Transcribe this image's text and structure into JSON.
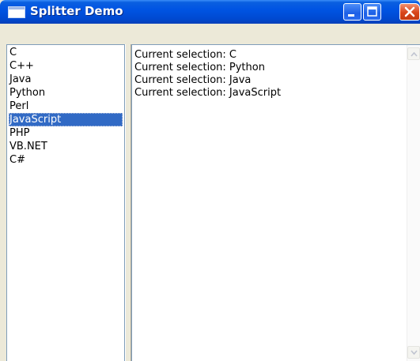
{
  "window": {
    "title": "Splitter Demo",
    "icons": {
      "app": "window-icon",
      "minimize": "minimize-icon",
      "maximize": "maximize-icon",
      "close": "close-icon"
    }
  },
  "language_list": {
    "items": [
      "C",
      "C++",
      "Java",
      "Python",
      "Perl",
      "JavaScript",
      "PHP",
      "VB.NET",
      "C#"
    ],
    "selected": "JavaScript"
  },
  "output": {
    "lines": [
      "Current selection: C",
      "Current selection: Python",
      "Current selection: Java",
      "Current selection: JavaScript"
    ]
  },
  "colors": {
    "titlebar": "#0054e3",
    "selection": "#316ac5",
    "close_button": "#d8451a"
  }
}
